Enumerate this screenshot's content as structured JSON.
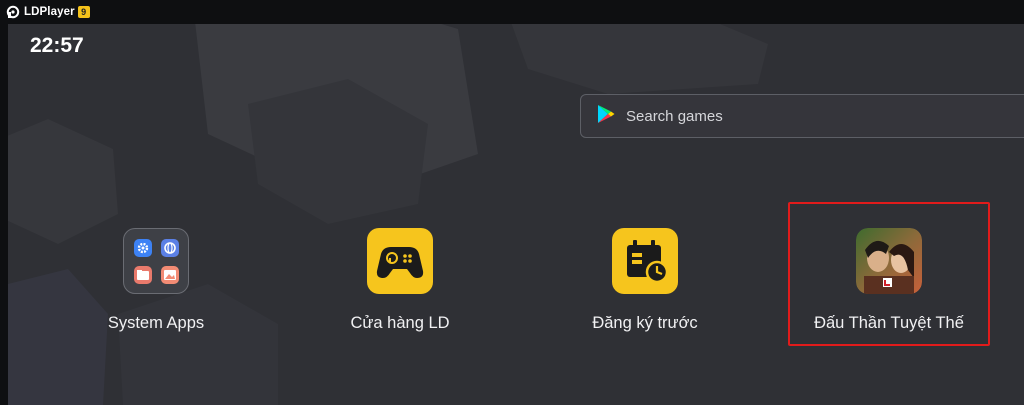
{
  "titlebar": {
    "app_name": "LDPlayer",
    "version_badge": "9"
  },
  "status": {
    "time": "22:57"
  },
  "search": {
    "placeholder": "Search games",
    "icon": "play-store-icon"
  },
  "apps": [
    {
      "label": "System Apps",
      "icon": "folder-icon"
    },
    {
      "label": "Cửa hàng LD",
      "icon": "gamepad-icon"
    },
    {
      "label": "Đăng ký trước",
      "icon": "calendar-clock-icon"
    },
    {
      "label": "Đấu Thần Tuyệt Thế",
      "icon": "game-icon"
    }
  ],
  "colors": {
    "accent_yellow": "#f6c51d",
    "highlight_red": "#e11b1b",
    "background": "#2f3035"
  }
}
